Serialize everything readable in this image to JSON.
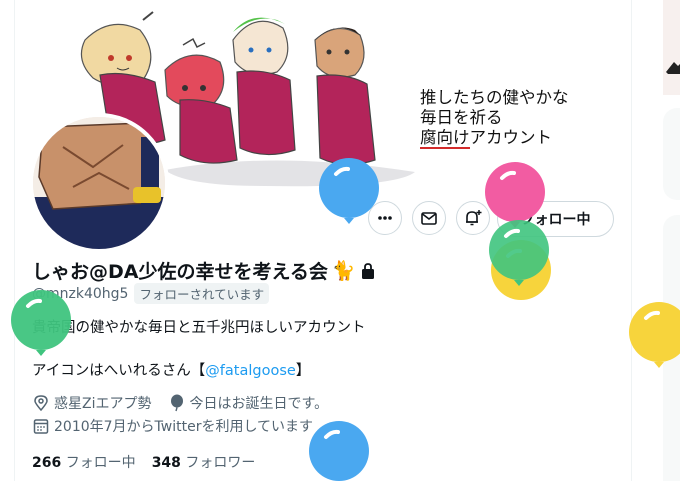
{
  "banner": {
    "line1": "推したちの健やかな",
    "line2": "毎日を祈る",
    "line3_underlined": "腐向け",
    "line3_rest": "アカウント"
  },
  "profile": {
    "name": "しゃお@DA少佐の幸せを考える会",
    "name_emoji": "🐈",
    "handle": "@mnzk40hg5",
    "follows_you": "フォローされています",
    "bio_line1": "貴帝国の健やかな毎日と五千兆円ほしいアカウント",
    "bio_line2_pre": "アイコンはへいれるさん【",
    "bio_line2_link": "@fatalgoose",
    "bio_line2_post": "】",
    "location": "惑星Ziエアプ勢",
    "birthday": "今日はお誕生日です。",
    "joined": "2010年7月からTwitterを利用しています",
    "following_count": "266",
    "following_label": "フォロー中",
    "followers_count": "348",
    "followers_label": "フォロワー"
  },
  "actions": {
    "follow_button": "フォロー中",
    "more_icon": "more-icon",
    "message_icon": "mail-icon",
    "notify_icon": "bell-plus-icon"
  },
  "colors": {
    "accent": "#1d9bf0",
    "balloon_blue": "#4aa8f0",
    "balloon_pink": "#f25ca2",
    "balloon_green": "#3fc47e",
    "balloon_yellow": "#f7d43c"
  }
}
